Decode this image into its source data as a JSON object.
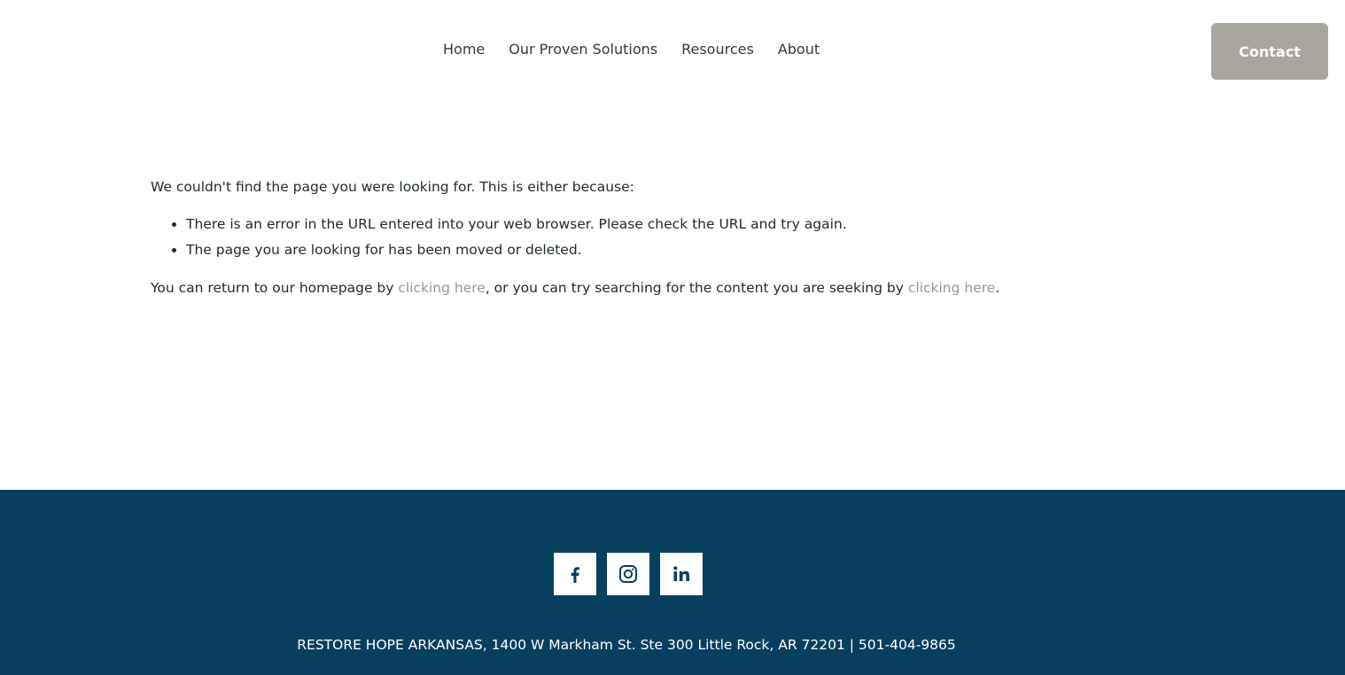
{
  "header": {
    "nav": [
      {
        "label": "Home"
      },
      {
        "label": "Our Proven Solutions"
      },
      {
        "label": "Resources"
      },
      {
        "label": "About"
      }
    ],
    "contact_label": "Contact"
  },
  "main": {
    "intro": "We couldn't find the page you were looking for. This is either because:",
    "reasons": [
      "There is an error in the URL entered into your web browser. Please check the URL and try again.",
      "The page you are looking for has been moved or deleted."
    ],
    "return_prefix": "You can return to our homepage by ",
    "link1": "clicking here",
    "return_middle": ", or you can try searching for the content you are seeking by ",
    "link2": "clicking here",
    "return_suffix": "."
  },
  "footer": {
    "social": [
      {
        "icon": "facebook-icon"
      },
      {
        "icon": "instagram-icon"
      },
      {
        "icon": "linkedin-icon"
      }
    ],
    "address": "RESTORE HOPE ARKANSAS, 1400 W Markham St. Ste 300 Little Rock, AR 72201  |  501-404-9865"
  },
  "colors": {
    "footer_bg": "#07405e",
    "contact_bg": "#a8a69f",
    "link": "#9a9893"
  }
}
